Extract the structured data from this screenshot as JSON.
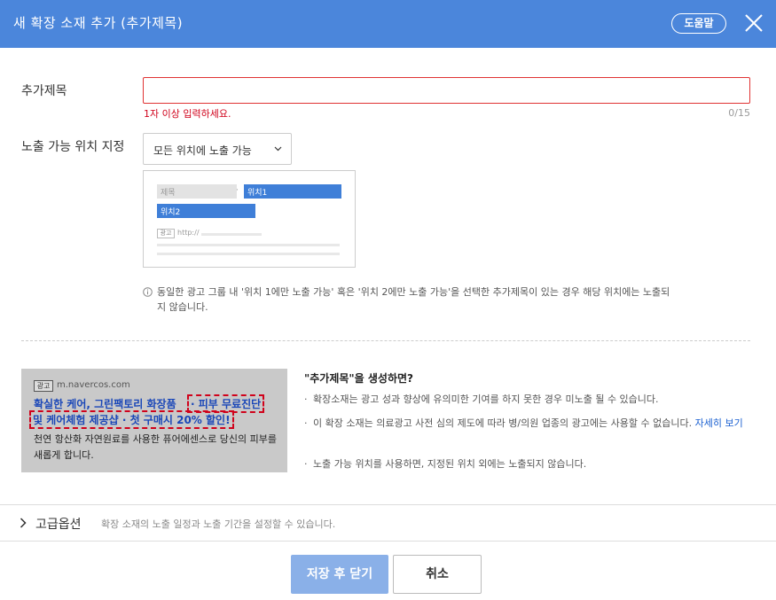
{
  "header": {
    "title": "새 확장 소재 추가 (추가제목)",
    "help_label": "도움말"
  },
  "form": {
    "title_field": {
      "label": "추가제목",
      "value": "",
      "placeholder": "",
      "error": "1자 이상 입력하세요.",
      "counter": "0/15"
    },
    "position_field": {
      "label": "노출 가능 위치 지정",
      "selected": "모든 위치에 노출 가능"
    },
    "preview": {
      "title_placeholder": "제목",
      "dot": "·",
      "location1": "위치1",
      "location2": "위치2",
      "ad_badge": "광고",
      "url": "http://"
    },
    "notice": "동일한 광고 그룹 내 '위치 1에만 노출 가능' 혹은 '위치 2에만 노출 가능'을 선택한 추가제목이 있는 경우 해당 위치에는 노출되지 않습니다."
  },
  "sample_ad": {
    "badge": "광고",
    "url": "m.navercos.com",
    "headline": "확실한 케어, 그린팩토리 화장품",
    "extension1": "· 피부 무료진단",
    "extension2": "및 케어체험 제공샵 · 첫 구매시 20% 할인!",
    "description": "천연 항산화 자연원료를 사용한 퓨어에센스로 당신의 피부를 새롭게 합니다."
  },
  "guide": {
    "title": "\"추가제목\"을 생성하면?",
    "bullet": "·",
    "items": [
      "확장소재는 광고 성과 향상에 유의미한 기여를 하지 못한 경우 미노출 될 수 있습니다.",
      "이 확장 소재는 의료광고 사전 심의 제도에 따라 병/의원 업종의 광고에는 사용할 수 없습니다.",
      "노출 가능 위치를 사용하면, 지정된 위치 외에는 노출되지 않습니다."
    ],
    "link": "자세히 보기"
  },
  "advanced": {
    "label": "고급옵션",
    "description": "확장 소재의 노출 일정과 노출 기간을 설정할 수 있습니다."
  },
  "footer": {
    "save_label": "저장 후 닫기",
    "cancel_label": "취소"
  },
  "colors": {
    "header_bg": "#4b86db",
    "error": "#d0021b",
    "preview_highlight": "#3f7fd8",
    "save_disabled": "#8ab0e8",
    "link": "#1a60d1"
  },
  "icons": [
    "close-icon",
    "chevron-down-icon",
    "info-icon",
    "chevron-right-icon"
  ]
}
